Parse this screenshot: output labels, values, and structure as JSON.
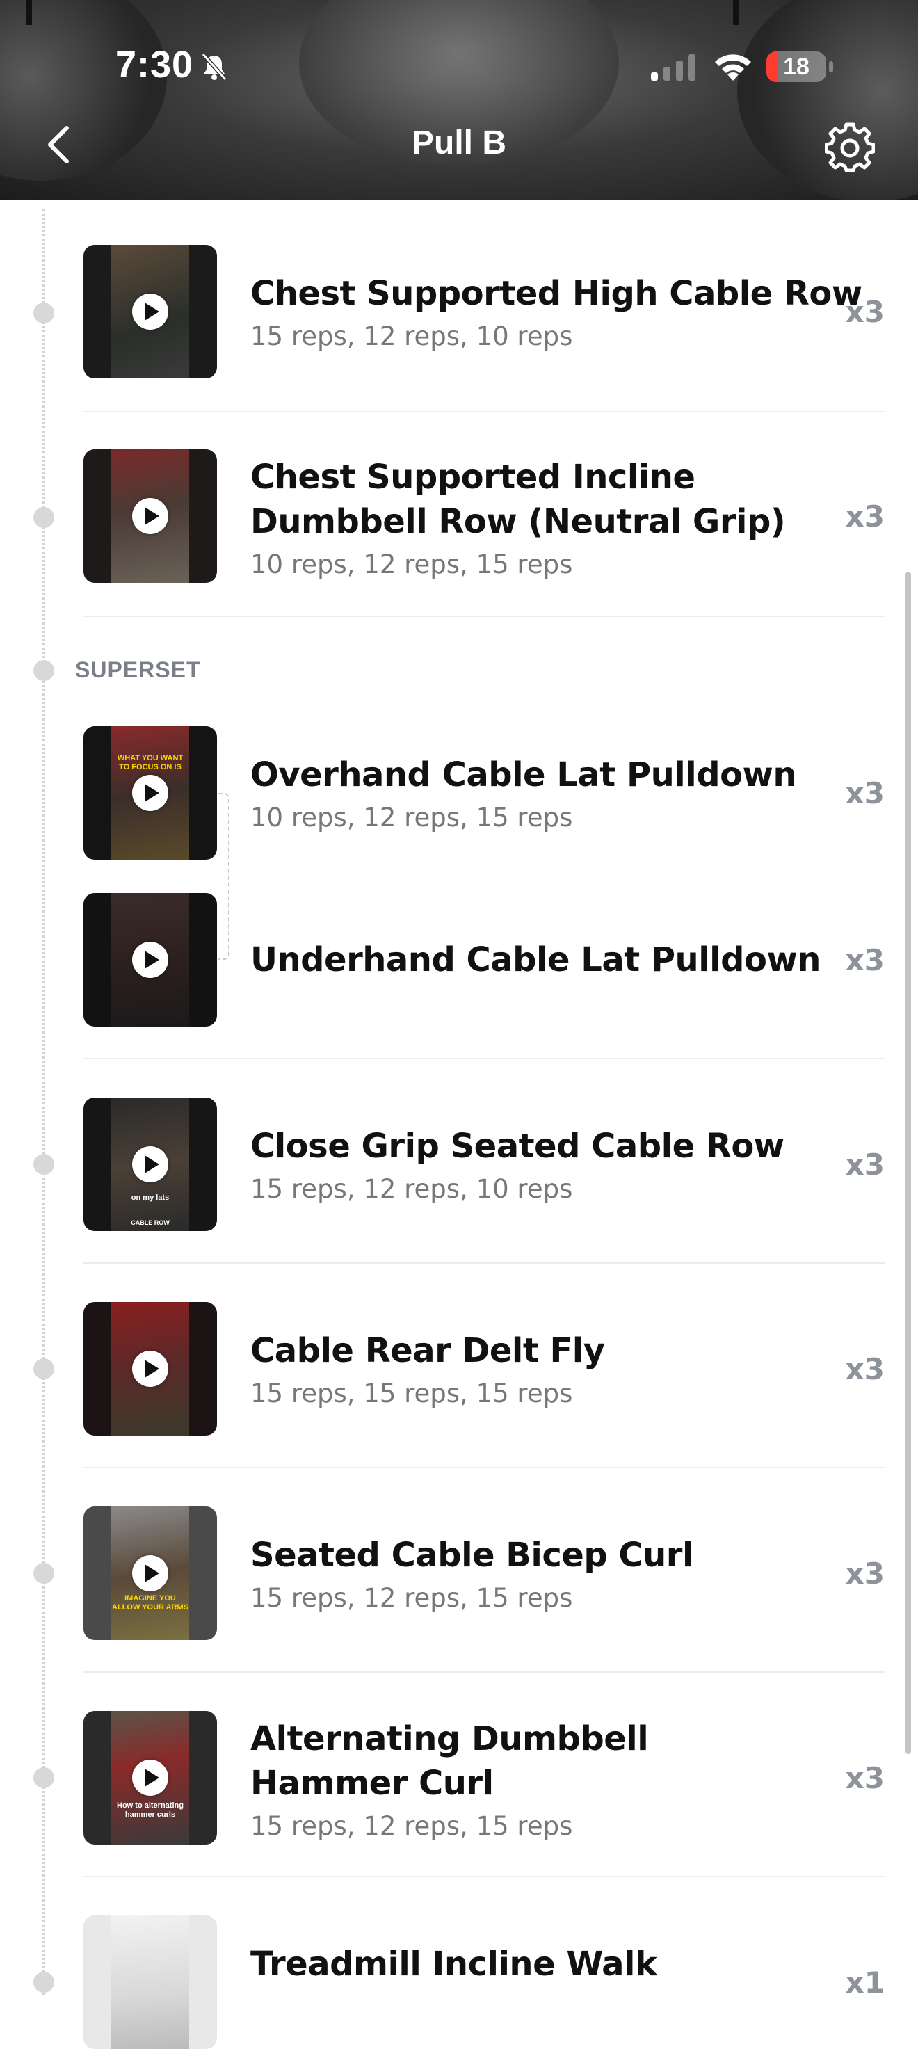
{
  "status_bar": {
    "time": "7:30",
    "battery_level": "18",
    "battery_fraction": 0.18,
    "battery_color": "#ff3b30",
    "icons": [
      "bell-slash-icon",
      "cellular-signal-icon",
      "wifi-icon",
      "battery-icon"
    ]
  },
  "header": {
    "title": "Pull B",
    "back_icon": "chevron-left-icon",
    "settings_icon": "gear-icon"
  },
  "section": {
    "superset_label": "SUPERSET"
  },
  "exercises": [
    {
      "name_lines": [
        "Chest Supported High Cable Row"
      ],
      "reps": "15 reps, 12 reps, 10 reps",
      "sets": "x3"
    },
    {
      "name_lines": [
        "Chest Supported Incline",
        "Dumbbell Row (Neutral Grip)"
      ],
      "reps": "10 reps, 12 reps, 15 reps",
      "sets": "x3"
    },
    {
      "name_lines": [
        "Overhand Cable Lat Pulldown"
      ],
      "reps": "10 reps, 12 reps, 15 reps",
      "sets": "x3",
      "thumb_caption": "WHAT YOU WANT TO FOCUS ON IS"
    },
    {
      "name_lines": [
        "Underhand Cable Lat Pulldown"
      ],
      "reps": "",
      "sets": "x3"
    },
    {
      "name_lines": [
        "Close Grip Seated Cable Row"
      ],
      "reps": "15 reps, 12 reps, 10 reps",
      "sets": "x3",
      "thumb_caption": "on my lats",
      "thumb_caption_2": "CABLE ROW"
    },
    {
      "name_lines": [
        "Cable Rear Delt Fly"
      ],
      "reps": "15 reps, 15 reps, 15 reps",
      "sets": "x3"
    },
    {
      "name_lines": [
        "Seated Cable Bicep Curl"
      ],
      "reps": "15 reps, 12 reps, 15 reps",
      "sets": "x3",
      "thumb_caption": "IMAGINE YOU ALLOW YOUR ARMS"
    },
    {
      "name_lines": [
        "Alternating Dumbbell",
        "Hammer Curl"
      ],
      "reps": "15 reps, 12 reps, 15 reps",
      "sets": "x3",
      "thumb_caption": "How to alternating hammer curls"
    },
    {
      "name_lines": [
        "Treadmill Incline Walk"
      ],
      "reps": "",
      "sets": "x1"
    }
  ]
}
